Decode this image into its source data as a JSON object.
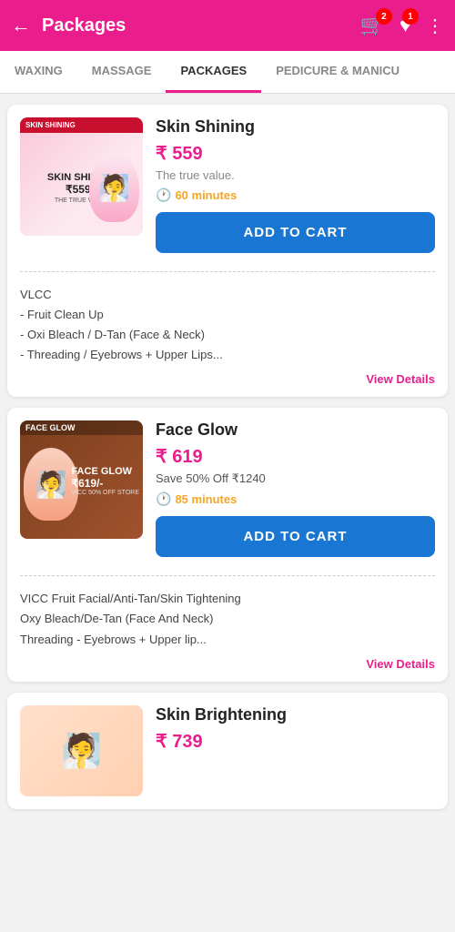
{
  "header": {
    "back_icon": "←",
    "title": "Packages",
    "cart_count": "2",
    "wishlist_count": "1",
    "more_icon": "⋮"
  },
  "tabs": [
    {
      "label": "WAXING",
      "active": false
    },
    {
      "label": "MASSAGE",
      "active": false
    },
    {
      "label": "PACKAGES",
      "active": true
    },
    {
      "label": "PEDICURE & MANICU",
      "active": false
    }
  ],
  "products": [
    {
      "id": "skin-shining",
      "name": "Skin Shining",
      "price": "₹ 559",
      "tagline": "The true value.",
      "duration": "60 minutes",
      "add_to_cart": "ADD TO CART",
      "description": "VLCC\n- Fruit Clean Up\n- Oxi Bleach / D-Tan (Face & Neck)\n- Threading / Eyebrows + Upper Lips...",
      "view_details": "View Details"
    },
    {
      "id": "face-glow",
      "name": "Face Glow",
      "price": "₹ 619",
      "save": "Save 50% Off ₹1240",
      "duration": "85 minutes",
      "add_to_cart": "ADD TO CART",
      "description": "VICC Fruit Facial/Anti-Tan/Skin Tightening\nOxy Bleach/De-Tan (Face And Neck)\nThreading - Eyebrows + Upper lip...",
      "view_details": "View Details"
    },
    {
      "id": "skin-brightening",
      "name": "Skin Brightening",
      "price": "₹ 739"
    }
  ]
}
